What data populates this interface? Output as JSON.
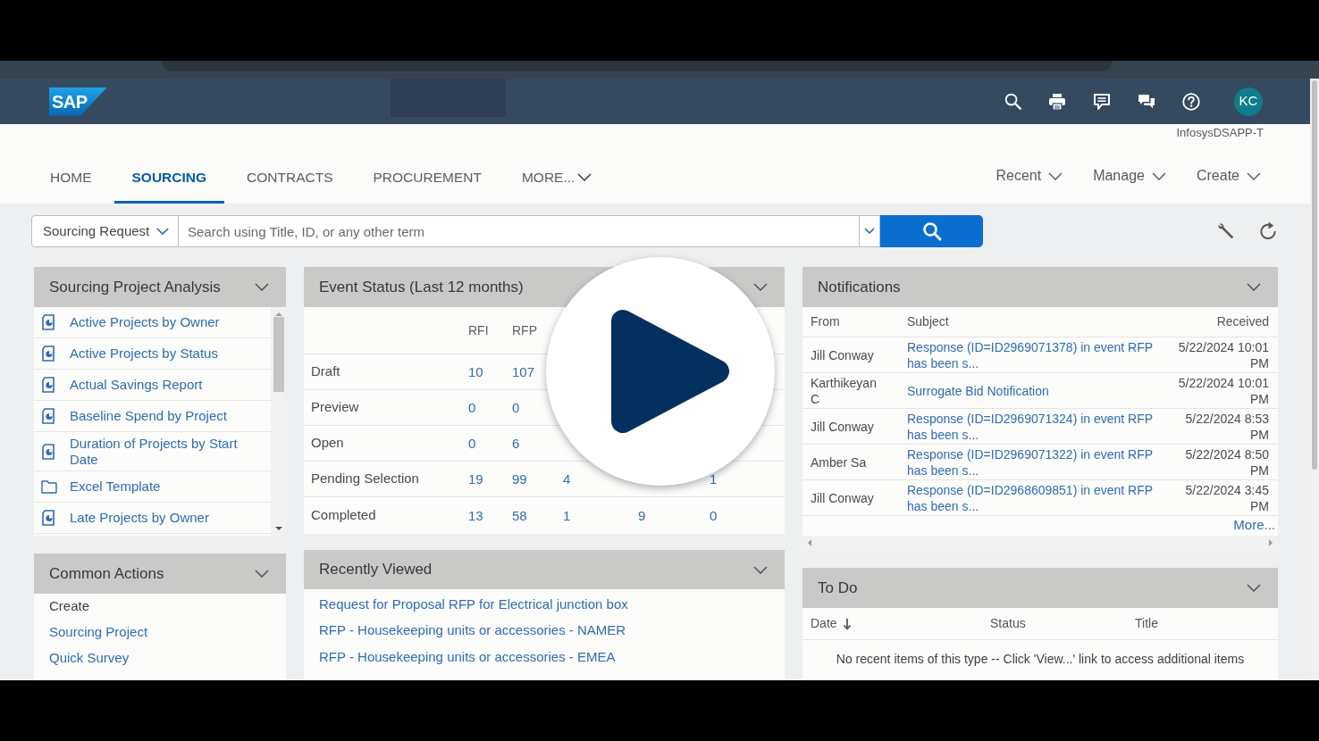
{
  "header": {
    "logo": "SAP",
    "user": {
      "initials": "KC"
    },
    "tenant": "InfosysDSAPP-T"
  },
  "tabs": [
    {
      "label": "HOME",
      "selected": false,
      "kind": "tab"
    },
    {
      "label": "SOURCING",
      "selected": true,
      "kind": "tab"
    },
    {
      "label": "CONTRACTS",
      "selected": false,
      "kind": "tab"
    },
    {
      "label": "PROCUREMENT",
      "selected": false,
      "kind": "tab"
    },
    {
      "label": "MORE...",
      "selected": false,
      "kind": "menu"
    }
  ],
  "menus": [
    "Recent",
    "Manage",
    "Create"
  ],
  "search": {
    "scope": "Sourcing Request",
    "placeholder": "Search using Title, ID, or any other term"
  },
  "sourcing_project_analysis": {
    "title": "Sourcing Project Analysis",
    "items": [
      {
        "label": "Active Projects by Owner",
        "kind": "report"
      },
      {
        "label": "Active Projects by Status",
        "kind": "report"
      },
      {
        "label": "Actual Savings Report",
        "kind": "report"
      },
      {
        "label": "Baseline Spend by Project",
        "kind": "report"
      },
      {
        "label": "Duration of Projects by Start Date",
        "kind": "report"
      },
      {
        "label": "Excel Template",
        "kind": "folder"
      },
      {
        "label": "Late Projects by Owner",
        "kind": "report"
      }
    ]
  },
  "common_actions": {
    "title": "Common Actions",
    "items": [
      {
        "label": "Create",
        "kind": "heading"
      },
      {
        "label": "Sourcing Project",
        "kind": "link"
      },
      {
        "label": "Quick Survey",
        "kind": "link"
      }
    ]
  },
  "event_status": {
    "title": "Event Status (Last 12 months)",
    "columns": {
      "rfi": "RFI",
      "rfp": "RFP"
    },
    "rows": [
      {
        "label": "Draft",
        "rfi": "10",
        "rfp": "107"
      },
      {
        "label": "Preview",
        "rfi": "0",
        "rfp": "0"
      },
      {
        "label": "Open",
        "rfi": "0",
        "rfp": "6"
      },
      {
        "label": "Pending Selection",
        "rfi": "19",
        "rfp": "99",
        "column_3": "4",
        "column_5": "1"
      },
      {
        "label": "Completed",
        "rfi": "13",
        "rfp": "58",
        "column_3": "1",
        "column_4": "9",
        "column_5": "0"
      }
    ]
  },
  "recently_viewed": {
    "title": "Recently Viewed",
    "items": [
      "Request for Proposal RFP for Electrical junction box",
      "RFP - Housekeeping units or accessories - NAMER",
      "RFP - Housekeeping units or accessories - EMEA"
    ]
  },
  "notifications": {
    "title": "Notifications",
    "columns": [
      "From",
      "Subject",
      "Received"
    ],
    "rows": [
      {
        "from": "Jill Conway",
        "subject": "Response (ID=ID2969071378) in event RFP has been s...",
        "received": "5/22/2024 10:01 PM"
      },
      {
        "from": "Karthikeyan C",
        "subject": "Surrogate Bid Notification",
        "received": "5/22/2024 10:01 PM"
      },
      {
        "from": "Jill Conway",
        "subject": "Response (ID=ID2969071324) in event RFP has been s...",
        "received": "5/22/2024 8:53 PM"
      },
      {
        "from": "Amber Sa",
        "subject": "Response (ID=ID2969071322) in event RFP has been s...",
        "received": "5/22/2024 8:50 PM"
      },
      {
        "from": "Jill Conway",
        "subject": "Response (ID=ID2968609851) in event RFP has been s...",
        "received": "5/22/2024 3:45 PM"
      }
    ],
    "more_link": "More..."
  },
  "todo": {
    "title": "To Do",
    "columns": [
      {
        "label": "Date",
        "sorted": true
      },
      {
        "label": "Status",
        "sorted": false
      },
      {
        "label": "Title",
        "sorted": false
      }
    ],
    "empty_message": "No recent items of this type -- Click 'View...' link to access additional items"
  }
}
